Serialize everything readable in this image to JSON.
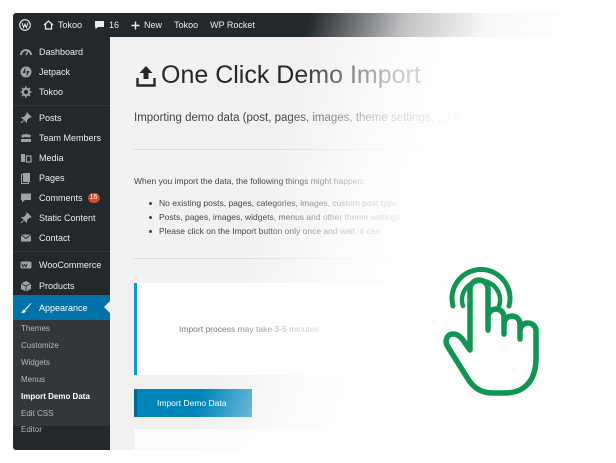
{
  "admin_bar": {
    "site_name": "Tokoo",
    "comments_count": "16",
    "new_label": "New",
    "items": [
      "Tokoo",
      "WP Rocket"
    ]
  },
  "sidebar": {
    "items": [
      {
        "label": "Dashboard",
        "icon": "dashboard-icon"
      },
      {
        "label": "Jetpack",
        "icon": "jetpack-icon"
      },
      {
        "label": "Tokoo",
        "icon": "gear-icon"
      },
      {
        "label": "Posts",
        "icon": "pin-icon"
      },
      {
        "label": "Team Members",
        "icon": "team-icon"
      },
      {
        "label": "Media",
        "icon": "media-icon"
      },
      {
        "label": "Pages",
        "icon": "pages-icon"
      },
      {
        "label": "Comments",
        "icon": "comment-icon",
        "badge": "16"
      },
      {
        "label": "Static Content",
        "icon": "pin-icon"
      },
      {
        "label": "Contact",
        "icon": "envelope-icon"
      },
      {
        "label": "WooCommerce",
        "icon": "woo-icon"
      },
      {
        "label": "Products",
        "icon": "box-icon"
      }
    ],
    "active": {
      "label": "Appearance",
      "icon": "brush-icon"
    },
    "submenu": [
      "Themes",
      "Customize",
      "Widgets",
      "Menus",
      "Import Demo Data",
      "Edit CSS",
      "Editor"
    ],
    "current_submenu": "Import Demo Data"
  },
  "content": {
    "title": "One Click Demo Import",
    "intro": "Importing demo data (post, pages, images, theme settings, ...) is the easi",
    "things_label": "When you import the data, the following things might happen:",
    "bullets": [
      "No existing posts, pages, categories, images, custom post type",
      "Posts, pages, images, widgets, menus and other theme settings",
      "Please click on the Import button only once and wait, it can"
    ],
    "notice": "Import process may take 3-5 minutes",
    "import_button": "Import Demo Data"
  },
  "colors": {
    "admin_bar_bg": "#23282d",
    "active_menu": "#0073aa",
    "hand_green": "#0f9653",
    "button_blue": "#0085ba"
  }
}
